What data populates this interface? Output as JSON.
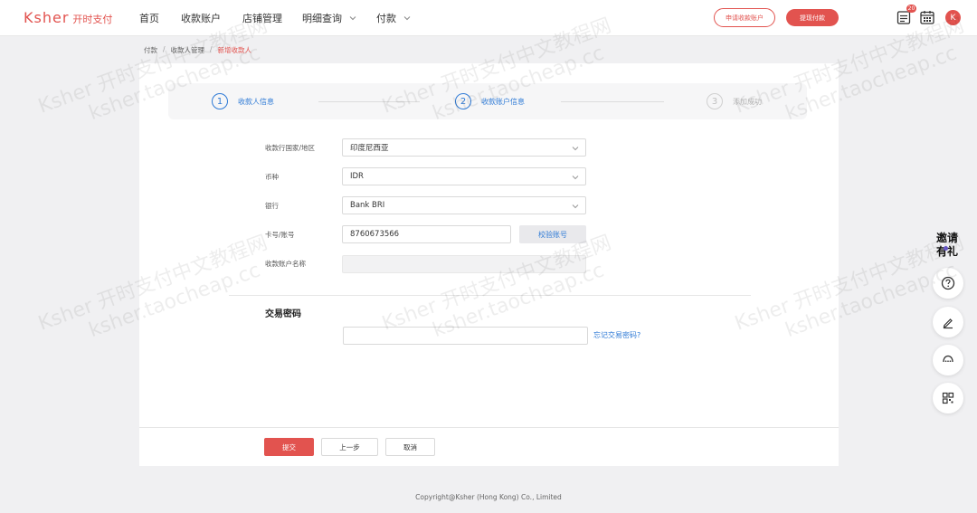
{
  "brand": {
    "name_en": "Ksher",
    "name_cn": "开时支付"
  },
  "nav": {
    "items": [
      {
        "label": "首页",
        "has_dropdown": false
      },
      {
        "label": "收款账户",
        "has_dropdown": false
      },
      {
        "label": "店铺管理",
        "has_dropdown": false
      },
      {
        "label": "明细查询",
        "has_dropdown": true
      },
      {
        "label": "付款",
        "has_dropdown": true
      }
    ],
    "apply_account_button": "申请收款账户",
    "withdraw_button": "提现付款",
    "notification_badge": "20",
    "avatar_letter": "K"
  },
  "breadcrumb": [
    "付款",
    "收款人管理",
    "新增收款人"
  ],
  "steps": [
    {
      "number": "1",
      "label": "收款人信息",
      "state": "done"
    },
    {
      "number": "2",
      "label": "收款账户信息",
      "state": "active"
    },
    {
      "number": "3",
      "label": "添加成功",
      "state": "inactive"
    }
  ],
  "form": {
    "country": {
      "label": "收款行国家/地区",
      "value": "印度尼西亚"
    },
    "currency": {
      "label": "币种",
      "value": "IDR"
    },
    "bank": {
      "label": "银行",
      "value": "Bank BRI"
    },
    "account_number": {
      "label": "卡号/账号",
      "value": "8760673566",
      "verify_button": "校验账号"
    },
    "account_name": {
      "label": "收款账户名称",
      "value": ""
    },
    "trade_password": {
      "title": "交易密码",
      "value": "",
      "forgot_link": "忘记交易密码?"
    }
  },
  "actions": {
    "submit": "提交",
    "previous": "上一步",
    "cancel": "取消"
  },
  "footer": {
    "copyright": "Copyright@Ksher (Hong Kong) Co., Limited"
  },
  "side_toolbar": {
    "promo_text": "邀请有礼",
    "icons": [
      "help-icon",
      "edit-icon",
      "customer-service-icon",
      "qrcode-icon"
    ]
  },
  "watermark": {
    "line1": "Ksher 开时支付中文教程网",
    "line2": "ksher.taocheap.cc"
  },
  "colors": {
    "brand_red": "#e2534f",
    "link_blue": "#2e7ad6",
    "page_bg": "#f0f0f2"
  }
}
